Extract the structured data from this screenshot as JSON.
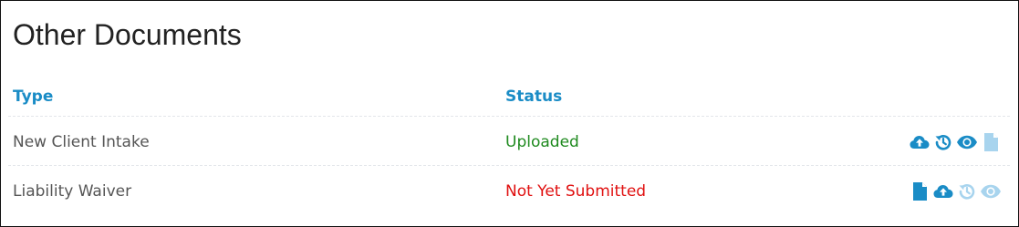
{
  "panel": {
    "title": "Other Documents"
  },
  "table": {
    "columns": {
      "type": "Type",
      "status": "Status"
    },
    "rows": [
      {
        "type": "New Client Intake",
        "status": "Uploaded",
        "actions": [
          "cloud-upload-icon",
          "history-icon",
          "eye-icon",
          "document-icon"
        ]
      },
      {
        "type": "Liability Waiver",
        "status": "Not Yet Submitted",
        "actions": [
          "document-icon",
          "cloud-upload-icon",
          "history-icon",
          "eye-icon"
        ]
      }
    ]
  },
  "colors": {
    "header_blue": "#1a8cc6",
    "icon_blue": "#1a8cc6",
    "icon_light_blue": "#a8d4ee",
    "status_uploaded": "#1f8a1f",
    "status_not_submitted": "#e01010"
  }
}
